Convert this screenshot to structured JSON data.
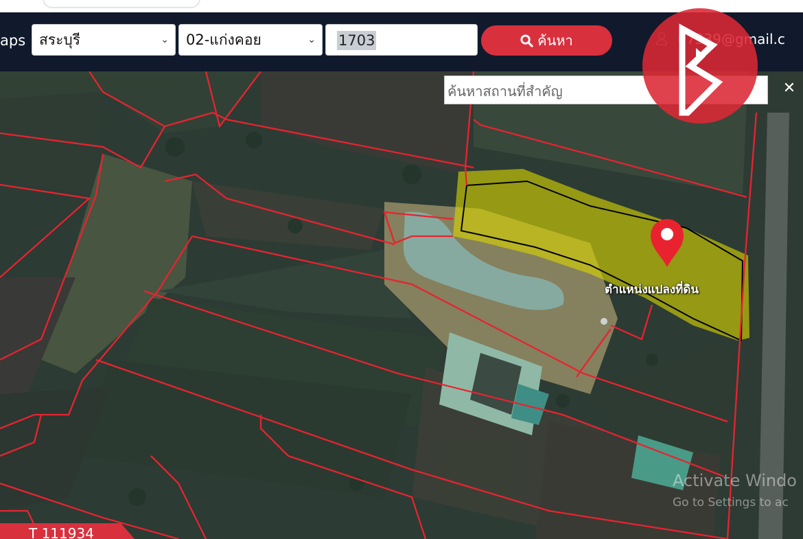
{
  "navbar": {
    "brand_fragment": "aps",
    "province_select": "สระบุรี",
    "district_select": "02-แก่งคอย",
    "deed_number": "1703",
    "search_button_label": "ค้นหา",
    "user_email_hidden": "",
    "user_email_visible": "07339@gmail.c"
  },
  "map": {
    "place_search_placeholder": "ค้นหาสถานที่สำคัญ",
    "close_label": "✕",
    "marker_label": "ตำแหน่งแปลงที่ดิน",
    "watermark_title": "Activate Windo",
    "watermark_sub": "Go to Settings to ac",
    "parcel_code": "T 111934"
  },
  "colors": {
    "navbar": "#101a2c",
    "accent_red": "#d9303e",
    "boundary_red": "#e8232f",
    "parcel_highlight": "#d9d400",
    "parcel_outline": "#000000"
  },
  "icons": {
    "search": "magnifier-icon",
    "user": "user-icon",
    "marker": "map-pin-icon",
    "close": "close-icon",
    "logo": "brand-logo"
  }
}
